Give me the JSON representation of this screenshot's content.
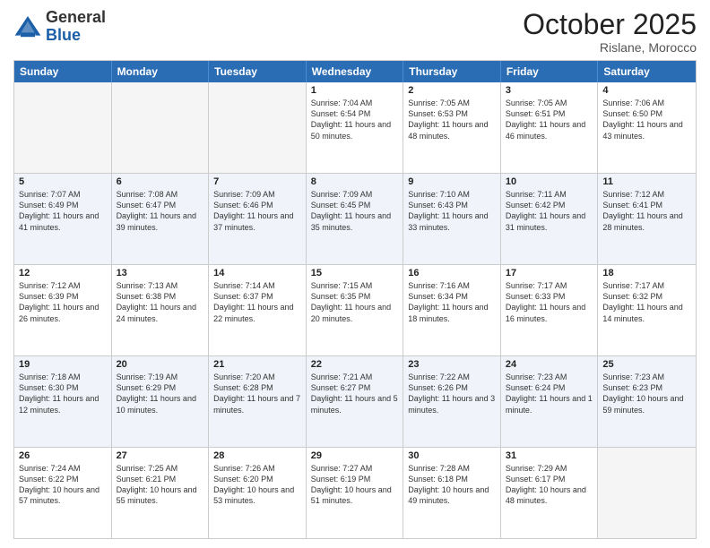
{
  "header": {
    "logo_general": "General",
    "logo_blue": "Blue",
    "month": "October 2025",
    "location": "Rislane, Morocco"
  },
  "weekdays": [
    "Sunday",
    "Monday",
    "Tuesday",
    "Wednesday",
    "Thursday",
    "Friday",
    "Saturday"
  ],
  "rows": [
    {
      "alt": false,
      "cells": [
        {
          "day": "",
          "info": ""
        },
        {
          "day": "",
          "info": ""
        },
        {
          "day": "",
          "info": ""
        },
        {
          "day": "1",
          "info": "Sunrise: 7:04 AM\nSunset: 6:54 PM\nDaylight: 11 hours and 50 minutes."
        },
        {
          "day": "2",
          "info": "Sunrise: 7:05 AM\nSunset: 6:53 PM\nDaylight: 11 hours and 48 minutes."
        },
        {
          "day": "3",
          "info": "Sunrise: 7:05 AM\nSunset: 6:51 PM\nDaylight: 11 hours and 46 minutes."
        },
        {
          "day": "4",
          "info": "Sunrise: 7:06 AM\nSunset: 6:50 PM\nDaylight: 11 hours and 43 minutes."
        }
      ]
    },
    {
      "alt": true,
      "cells": [
        {
          "day": "5",
          "info": "Sunrise: 7:07 AM\nSunset: 6:49 PM\nDaylight: 11 hours and 41 minutes."
        },
        {
          "day": "6",
          "info": "Sunrise: 7:08 AM\nSunset: 6:47 PM\nDaylight: 11 hours and 39 minutes."
        },
        {
          "day": "7",
          "info": "Sunrise: 7:09 AM\nSunset: 6:46 PM\nDaylight: 11 hours and 37 minutes."
        },
        {
          "day": "8",
          "info": "Sunrise: 7:09 AM\nSunset: 6:45 PM\nDaylight: 11 hours and 35 minutes."
        },
        {
          "day": "9",
          "info": "Sunrise: 7:10 AM\nSunset: 6:43 PM\nDaylight: 11 hours and 33 minutes."
        },
        {
          "day": "10",
          "info": "Sunrise: 7:11 AM\nSunset: 6:42 PM\nDaylight: 11 hours and 31 minutes."
        },
        {
          "day": "11",
          "info": "Sunrise: 7:12 AM\nSunset: 6:41 PM\nDaylight: 11 hours and 28 minutes."
        }
      ]
    },
    {
      "alt": false,
      "cells": [
        {
          "day": "12",
          "info": "Sunrise: 7:12 AM\nSunset: 6:39 PM\nDaylight: 11 hours and 26 minutes."
        },
        {
          "day": "13",
          "info": "Sunrise: 7:13 AM\nSunset: 6:38 PM\nDaylight: 11 hours and 24 minutes."
        },
        {
          "day": "14",
          "info": "Sunrise: 7:14 AM\nSunset: 6:37 PM\nDaylight: 11 hours and 22 minutes."
        },
        {
          "day": "15",
          "info": "Sunrise: 7:15 AM\nSunset: 6:35 PM\nDaylight: 11 hours and 20 minutes."
        },
        {
          "day": "16",
          "info": "Sunrise: 7:16 AM\nSunset: 6:34 PM\nDaylight: 11 hours and 18 minutes."
        },
        {
          "day": "17",
          "info": "Sunrise: 7:17 AM\nSunset: 6:33 PM\nDaylight: 11 hours and 16 minutes."
        },
        {
          "day": "18",
          "info": "Sunrise: 7:17 AM\nSunset: 6:32 PM\nDaylight: 11 hours and 14 minutes."
        }
      ]
    },
    {
      "alt": true,
      "cells": [
        {
          "day": "19",
          "info": "Sunrise: 7:18 AM\nSunset: 6:30 PM\nDaylight: 11 hours and 12 minutes."
        },
        {
          "day": "20",
          "info": "Sunrise: 7:19 AM\nSunset: 6:29 PM\nDaylight: 11 hours and 10 minutes."
        },
        {
          "day": "21",
          "info": "Sunrise: 7:20 AM\nSunset: 6:28 PM\nDaylight: 11 hours and 7 minutes."
        },
        {
          "day": "22",
          "info": "Sunrise: 7:21 AM\nSunset: 6:27 PM\nDaylight: 11 hours and 5 minutes."
        },
        {
          "day": "23",
          "info": "Sunrise: 7:22 AM\nSunset: 6:26 PM\nDaylight: 11 hours and 3 minutes."
        },
        {
          "day": "24",
          "info": "Sunrise: 7:23 AM\nSunset: 6:24 PM\nDaylight: 11 hours and 1 minute."
        },
        {
          "day": "25",
          "info": "Sunrise: 7:23 AM\nSunset: 6:23 PM\nDaylight: 10 hours and 59 minutes."
        }
      ]
    },
    {
      "alt": false,
      "cells": [
        {
          "day": "26",
          "info": "Sunrise: 7:24 AM\nSunset: 6:22 PM\nDaylight: 10 hours and 57 minutes."
        },
        {
          "day": "27",
          "info": "Sunrise: 7:25 AM\nSunset: 6:21 PM\nDaylight: 10 hours and 55 minutes."
        },
        {
          "day": "28",
          "info": "Sunrise: 7:26 AM\nSunset: 6:20 PM\nDaylight: 10 hours and 53 minutes."
        },
        {
          "day": "29",
          "info": "Sunrise: 7:27 AM\nSunset: 6:19 PM\nDaylight: 10 hours and 51 minutes."
        },
        {
          "day": "30",
          "info": "Sunrise: 7:28 AM\nSunset: 6:18 PM\nDaylight: 10 hours and 49 minutes."
        },
        {
          "day": "31",
          "info": "Sunrise: 7:29 AM\nSunset: 6:17 PM\nDaylight: 10 hours and 48 minutes."
        },
        {
          "day": "",
          "info": ""
        }
      ]
    }
  ]
}
